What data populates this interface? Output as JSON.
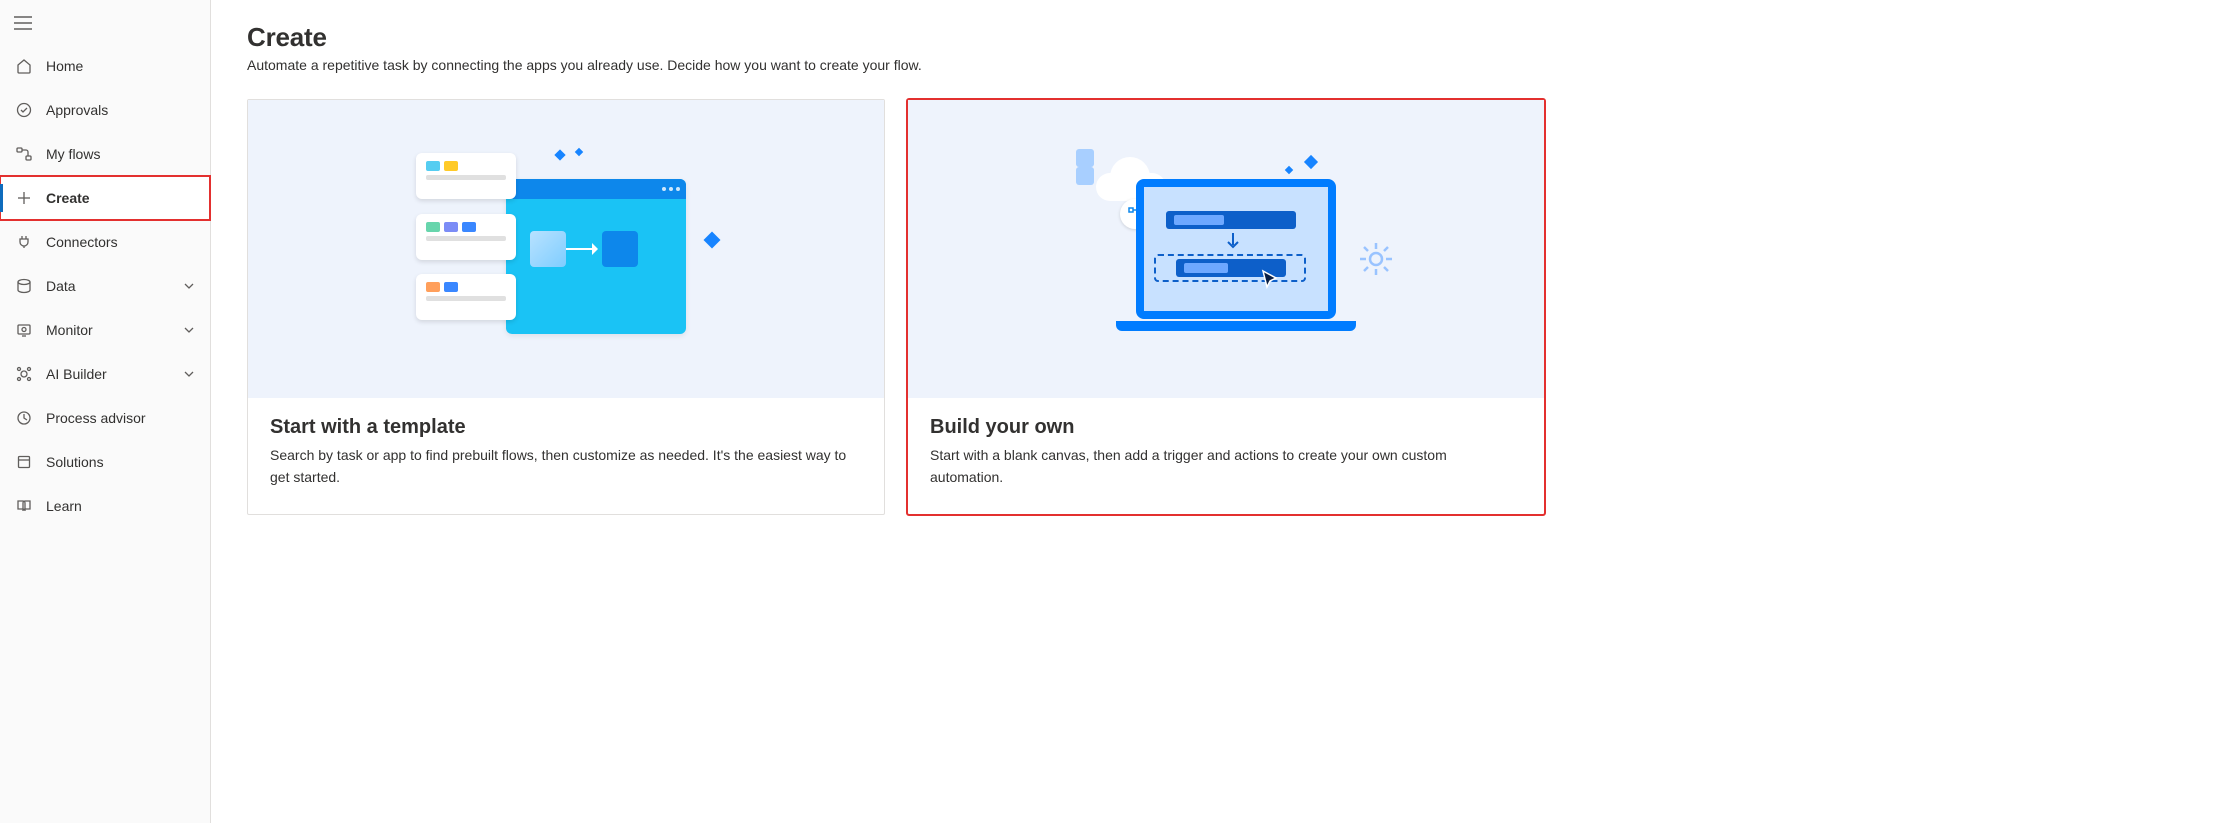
{
  "sidebar": {
    "items": [
      {
        "id": "home",
        "label": "Home",
        "icon": "home-icon",
        "expandable": false,
        "active": false
      },
      {
        "id": "approvals",
        "label": "Approvals",
        "icon": "approvals-icon",
        "expandable": false,
        "active": false
      },
      {
        "id": "my-flows",
        "label": "My flows",
        "icon": "myflows-icon",
        "expandable": false,
        "active": false
      },
      {
        "id": "create",
        "label": "Create",
        "icon": "plus-icon",
        "expandable": false,
        "active": true,
        "highlighted": true
      },
      {
        "id": "connectors",
        "label": "Connectors",
        "icon": "connectors-icon",
        "expandable": false,
        "active": false
      },
      {
        "id": "data",
        "label": "Data",
        "icon": "data-icon",
        "expandable": true,
        "active": false
      },
      {
        "id": "monitor",
        "label": "Monitor",
        "icon": "monitor-icon",
        "expandable": true,
        "active": false
      },
      {
        "id": "ai-builder",
        "label": "AI Builder",
        "icon": "aibuilder-icon",
        "expandable": true,
        "active": false
      },
      {
        "id": "process-advisor",
        "label": "Process advisor",
        "icon": "process-advisor-icon",
        "expandable": false,
        "active": false
      },
      {
        "id": "solutions",
        "label": "Solutions",
        "icon": "solutions-icon",
        "expandable": false,
        "active": false
      },
      {
        "id": "learn",
        "label": "Learn",
        "icon": "learn-icon",
        "expandable": false,
        "active": false
      }
    ]
  },
  "page": {
    "title": "Create",
    "subtitle": "Automate a repetitive task by connecting the apps you already use. Decide how you want to create your flow."
  },
  "cards": [
    {
      "id": "template",
      "title": "Start with a template",
      "description": "Search by task or app to find prebuilt flows, then customize as needed. It's the easiest way to get started.",
      "highlighted": false
    },
    {
      "id": "build",
      "title": "Build your own",
      "description": "Start with a blank canvas, then add a trigger and actions to create your own custom automation.",
      "highlighted": true
    }
  ]
}
